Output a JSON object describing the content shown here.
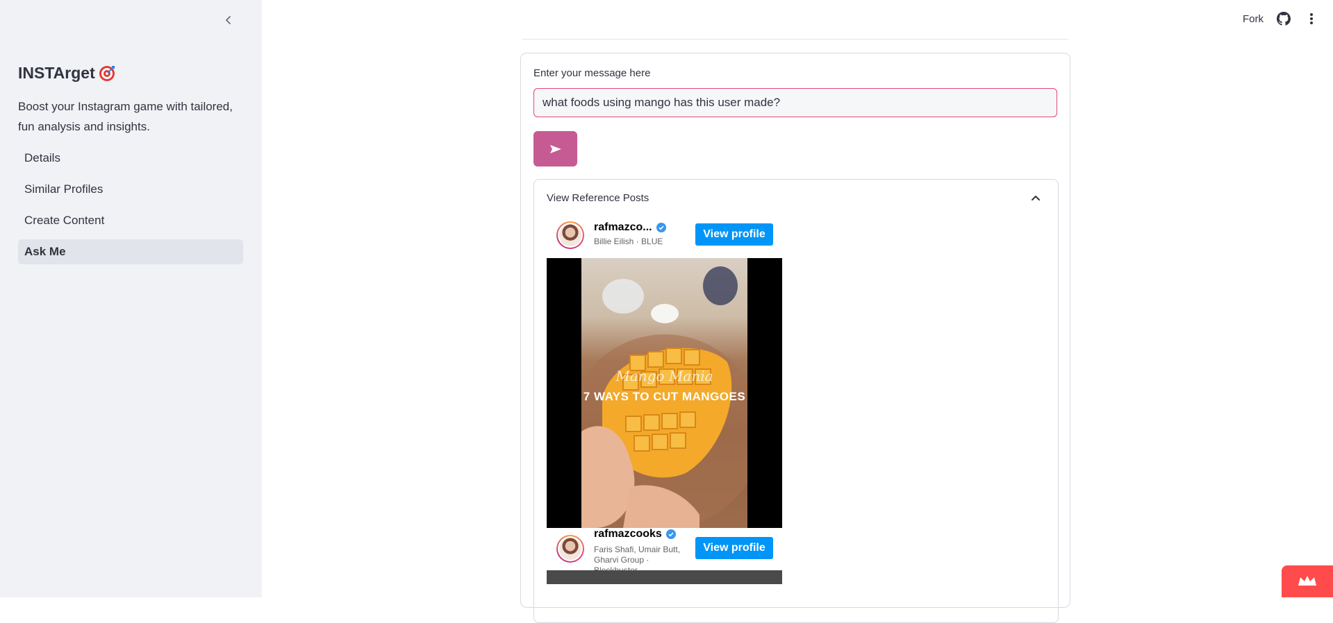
{
  "sidebar": {
    "title": "INSTArget",
    "description": "Boost your Instagram game with tailored, fun analysis and insights.",
    "nav": [
      {
        "label": "Details",
        "active": false
      },
      {
        "label": "Similar Profiles",
        "active": false
      },
      {
        "label": "Create Content",
        "active": false
      },
      {
        "label": "Ask Me",
        "active": true
      }
    ]
  },
  "topbar": {
    "fork_label": "Fork",
    "icons": [
      "github-icon",
      "more-vertical-icon"
    ]
  },
  "chat": {
    "input_label": "Enter your message here",
    "input_value": "what foods using mango has this user made?",
    "send_icon": "send-arrow-icon"
  },
  "references": {
    "header": "View Reference Posts",
    "posts": [
      {
        "handle": "rafmazco...",
        "music": "Billie Eilish · BLUE",
        "button": "View profile",
        "overlay_script": "Mango Mania",
        "overlay_title": "7 WAYS TO CUT MANGOES"
      },
      {
        "handle": "rafmazcooks",
        "music": "Faris Shafi, Umair Butt, Gharvi Group · Blockbuster",
        "button": "View profile"
      }
    ]
  },
  "colors": {
    "sidebar_bg": "#f0f2f6",
    "accent": "#c65a93",
    "input_border": "#e0457b",
    "instagram_blue": "#0095f6",
    "badge": "#ff4b4b"
  }
}
